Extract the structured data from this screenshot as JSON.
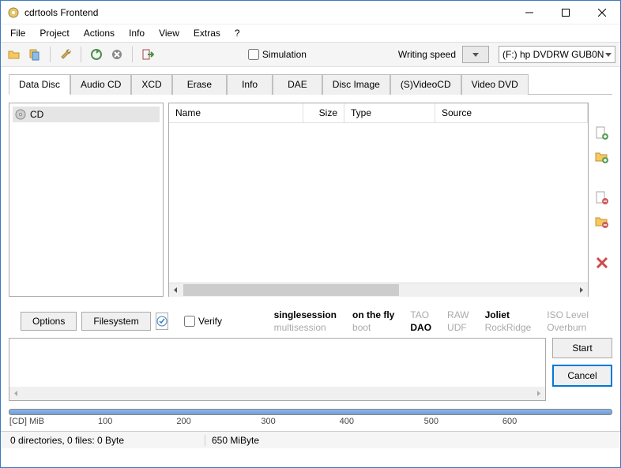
{
  "title": "cdrtools Frontend",
  "menu": [
    "File",
    "Project",
    "Actions",
    "Info",
    "View",
    "Extras",
    "?"
  ],
  "toolbar": {
    "simulation_label": "Simulation",
    "writing_speed_label": "Writing speed",
    "drive_label": "(F:) hp DVDRW  GUB0N"
  },
  "tabs": [
    "Data Disc",
    "Audio CD",
    "XCD",
    "Erase",
    "Info",
    "DAE",
    "Disc Image",
    "(S)VideoCD",
    "Video DVD"
  ],
  "tree": {
    "root_label": "CD"
  },
  "list": {
    "cols": [
      "Name",
      "Size",
      "Type",
      "Source"
    ]
  },
  "options": {
    "options_btn": "Options",
    "filesystem_btn": "Filesystem",
    "verify_label": "Verify"
  },
  "modes": {
    "r1": [
      "singlesession",
      "on the fly",
      "TAO",
      "RAW",
      "Joliet",
      "ISO Level"
    ],
    "r2": [
      "multisession",
      "boot",
      "DAO",
      "UDF",
      "RockRidge",
      "Overburn"
    ],
    "bold": [
      "singlesession",
      "on the fly",
      "DAO",
      "Joliet"
    ]
  },
  "actions": {
    "start": "Start",
    "cancel": "Cancel"
  },
  "ruler": {
    "unit_label": "[CD] MiB",
    "ticks": [
      "100",
      "200",
      "300",
      "400",
      "500",
      "600"
    ]
  },
  "status": {
    "left": "0 directories, 0 files: 0 Byte",
    "right": "650 MiByte"
  }
}
